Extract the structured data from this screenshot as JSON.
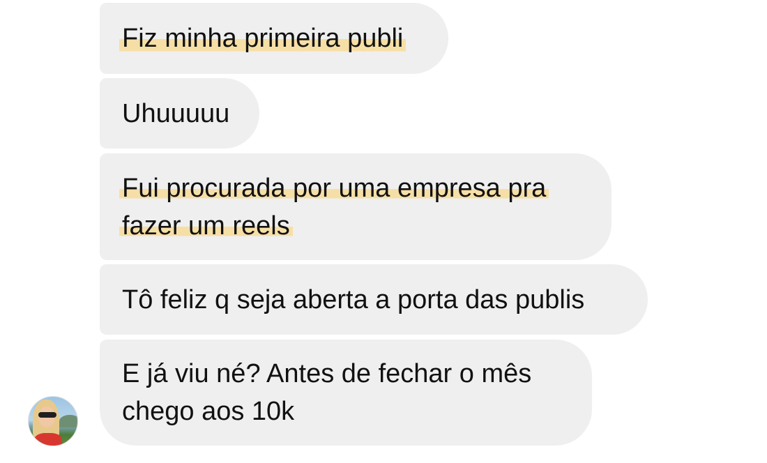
{
  "messages": [
    {
      "lines": [
        "Fiz minha primeira publi"
      ],
      "highlighted": true
    },
    {
      "lines": [
        "Uhuuuuu"
      ],
      "highlighted": false
    },
    {
      "lines": [
        "Fui procurada por uma empresa pra",
        "fazer um reels"
      ],
      "highlighted": true
    },
    {
      "lines": [
        "Tô feliz q seja aberta a porta das publis"
      ],
      "highlighted": false
    },
    {
      "lines": [
        "E já viu né? Antes de fechar o mês",
        "chego aos 10k"
      ],
      "highlighted": false
    }
  ],
  "colors": {
    "bubble_background": "#efefef",
    "highlight": "#f6dfa6",
    "text": "#111111",
    "page_background": "#ffffff"
  },
  "avatar": {
    "icon": "profile-photo-avatar"
  }
}
